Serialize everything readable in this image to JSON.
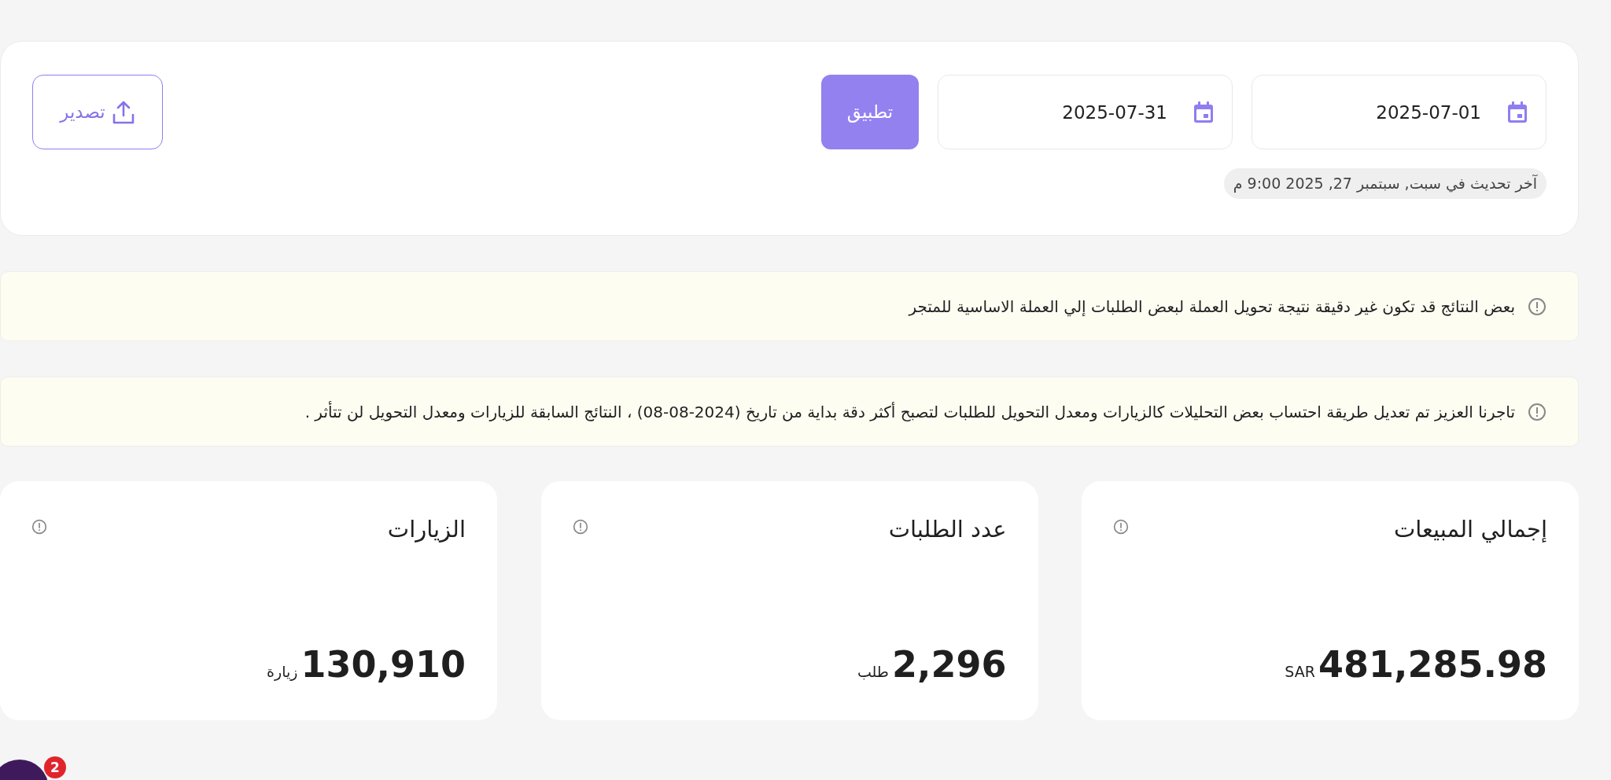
{
  "filters": {
    "start_date": "2025-07-01",
    "end_date": "2025-07-31",
    "apply_label": "تطبيق",
    "export_label": "تصدير",
    "last_updated": "آخر تحديث في سبت, سبتمبر 27, 2025 9:00 م"
  },
  "notices": [
    {
      "text": "بعض النتائج قد تكون غير دقيقة نتيجة تحويل العملة لبعض الطلبات إلي العملة الاساسية للمتجر"
    },
    {
      "text": "تاجرنا العزيز تم تعديل طريقة احتساب بعض التحليلات كالزيارات ومعدل التحويل للطلبات لتصبح أكثر دقة بداية من تاريخ (2024-08-08) ، النتائج السابقة للزيارات ومعدل التحويل لن تتأثر ."
    }
  ],
  "stats": [
    {
      "title": "إجمالي المبيعات",
      "value": "481,285.98",
      "unit": "SAR"
    },
    {
      "title": "عدد الطلبات",
      "value": "2,296",
      "unit": "طلب"
    },
    {
      "title": "الزيارات",
      "value": "130,910",
      "unit": "زيارة"
    }
  ],
  "chat_widget": {
    "badge": "2"
  }
}
